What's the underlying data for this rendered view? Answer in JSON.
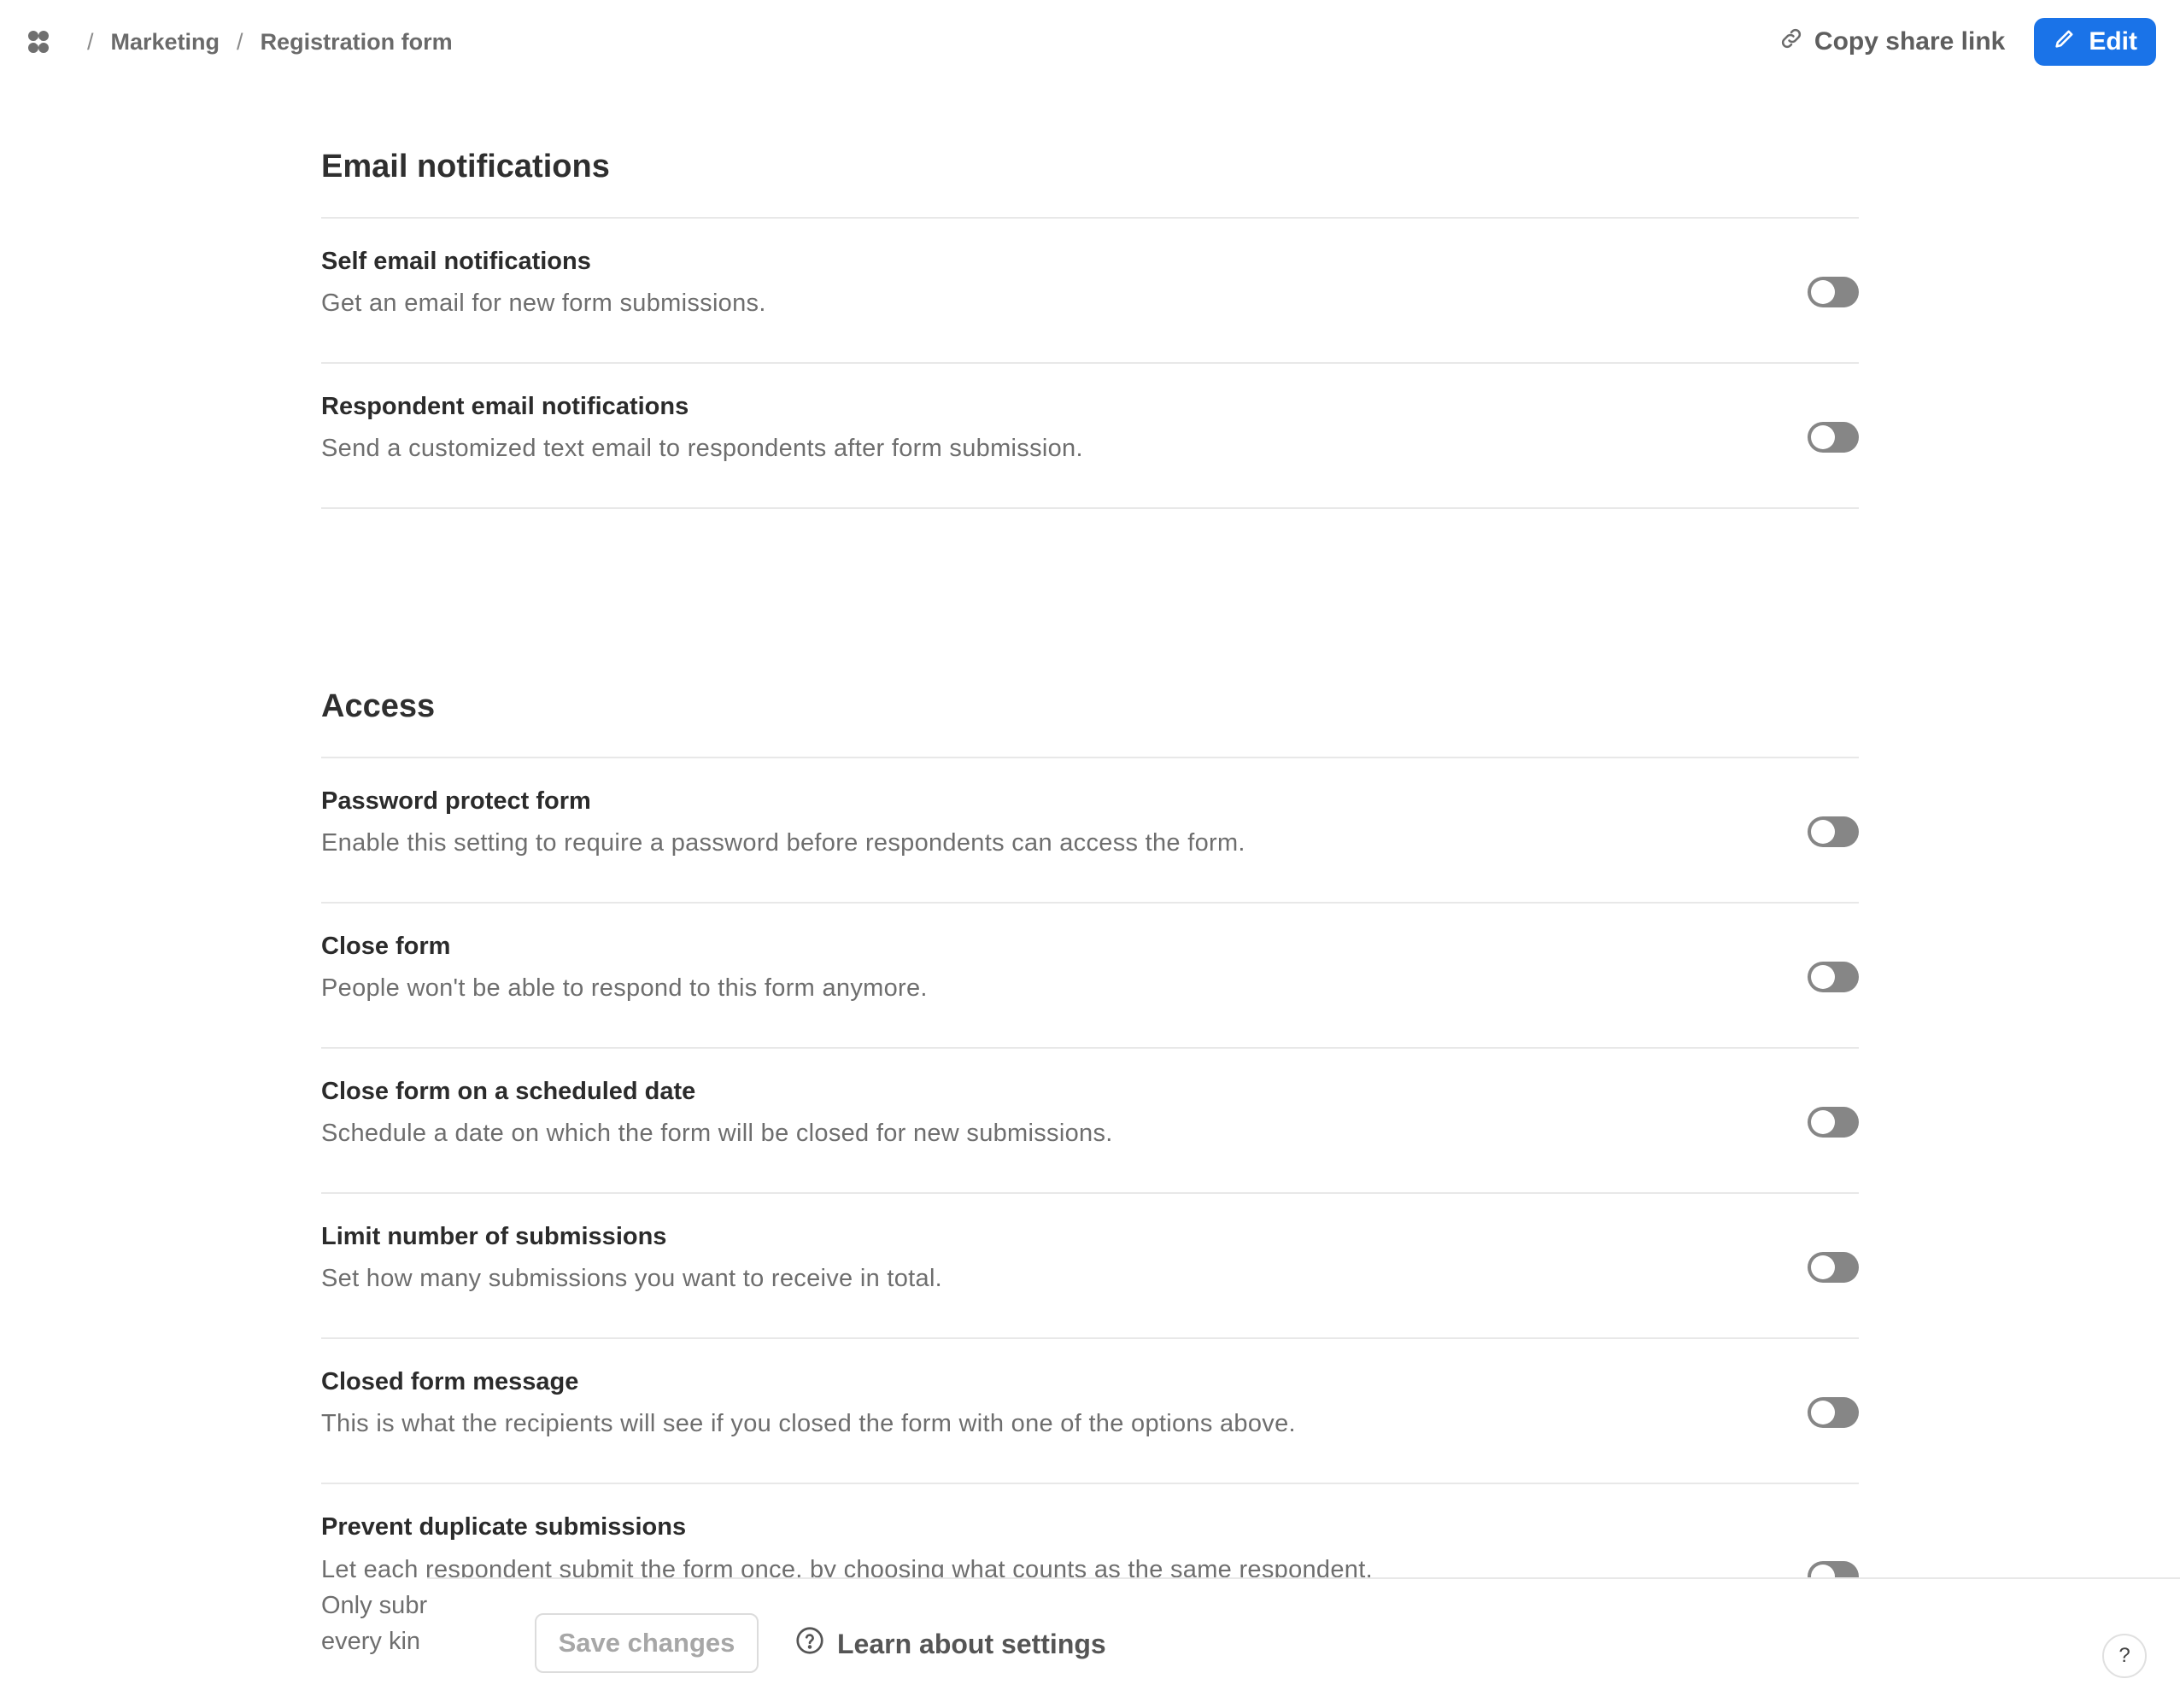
{
  "breadcrumb": {
    "items": [
      "Marketing",
      "Registration form"
    ],
    "separator": "/"
  },
  "header": {
    "share_label": "Copy share link",
    "edit_label": "Edit"
  },
  "sections": [
    {
      "title": "Email notifications",
      "settings": [
        {
          "title": "Self email notifications",
          "description": "Get an email for new form submissions.",
          "enabled": false
        },
        {
          "title": "Respondent email notifications",
          "description": "Send a customized text email to respondents after form submission.",
          "enabled": false
        }
      ]
    },
    {
      "title": "Access",
      "settings": [
        {
          "title": "Password protect form",
          "description": "Enable this setting to require a password before respondents can access the form.",
          "enabled": false
        },
        {
          "title": "Close form",
          "description": "People won't be able to respond to this form anymore.",
          "enabled": false
        },
        {
          "title": "Close form on a scheduled date",
          "description": "Schedule a date on which the form will be closed for new submissions.",
          "enabled": false
        },
        {
          "title": "Limit number of submissions",
          "description": "Set how many submissions you want to receive in total.",
          "enabled": false
        },
        {
          "title": "Closed form message",
          "description": "This is what the recipients will see if you closed the form with one of the options above.",
          "enabled": false
        }
      ]
    }
  ],
  "partial_setting": {
    "title": "Prevent duplicate submissions",
    "line1": "Let each respondent submit the form once, by choosing what counts as the same respondent.",
    "line2": "Only subr",
    "line3": "every kin"
  },
  "footer": {
    "save_label": "Save changes",
    "learn_label": "Learn about settings",
    "help_label": "?"
  },
  "colors": {
    "accent": "#1a73e8",
    "toggle_off": "#868686"
  }
}
